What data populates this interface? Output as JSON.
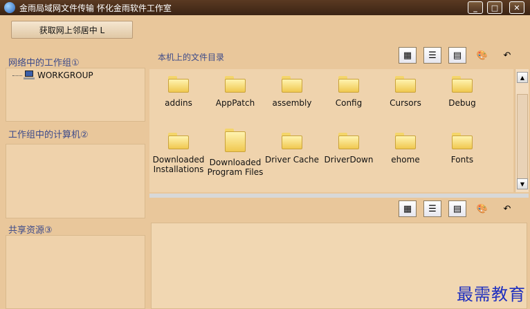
{
  "window": {
    "title": "金雨局域网文件传输   怀化金雨软件工作室",
    "minimize": "_",
    "maximize": "□",
    "close": "✕"
  },
  "left": {
    "get_neighbors_button": "获取网上邻居中 L",
    "workgroups_label": "网络中的工作组①",
    "workgroup_item": "WORKGROUP",
    "computers_label": "工作组中的计算机②",
    "shared_label": "共享资源③"
  },
  "files": {
    "header": "本机上的文件目录",
    "items": [
      {
        "label": "addins"
      },
      {
        "label": "AppPatch"
      },
      {
        "label": "assembly"
      },
      {
        "label": "Config"
      },
      {
        "label": "Cursors"
      },
      {
        "label": "Debug"
      },
      {
        "label": "Downloaded Installations"
      },
      {
        "label": "Downloaded Program Files"
      },
      {
        "label": "Driver Cache"
      },
      {
        "label": "DriverDown"
      },
      {
        "label": "ehome"
      },
      {
        "label": "Fonts"
      }
    ]
  },
  "toolbar": {
    "icons": [
      "large-icons-view-icon",
      "list-view-icon",
      "details-view-icon",
      "palette-icon",
      "up-folder-icon"
    ]
  },
  "watermark": "最需教育"
}
